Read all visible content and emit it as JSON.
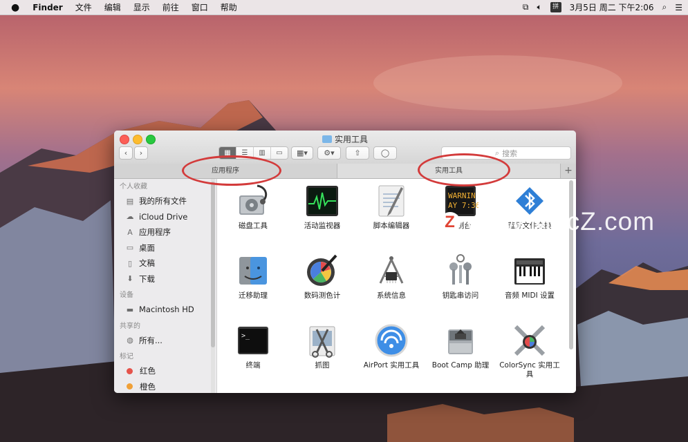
{
  "menubar": {
    "app_name": "Finder",
    "items": [
      "文件",
      "编辑",
      "显示",
      "前往",
      "窗口",
      "帮助"
    ],
    "clock": "3月5日 周二 下午2:06"
  },
  "window": {
    "title": "实用工具",
    "search_placeholder": "搜索",
    "tabs": [
      "应用程序",
      "实用工具"
    ],
    "active_tab": 1
  },
  "sidebar": {
    "favorites_header": "个人收藏",
    "favorites": [
      "我的所有文件",
      "iCloud Drive",
      "应用程序",
      "桌面",
      "文稿",
      "下载"
    ],
    "devices_header": "设备",
    "devices": [
      "Macintosh HD"
    ],
    "shared_header": "共享的",
    "shared": [
      "所有..."
    ],
    "tags_header": "标记",
    "tags": [
      {
        "label": "红色",
        "color": "#e5534b"
      },
      {
        "label": "橙色",
        "color": "#f0a037"
      }
    ]
  },
  "apps": [
    {
      "label": "磁盘工具",
      "icon": "disk-utility-icon"
    },
    {
      "label": "活动监视器",
      "icon": "activity-monitor-icon"
    },
    {
      "label": "脚本编辑器",
      "icon": "script-editor-icon"
    },
    {
      "label": "控制台",
      "icon": "console-icon",
      "screen_text": "WARNIN\nAY 7:36"
    },
    {
      "label": "蓝牙文件交换",
      "icon": "bluetooth-icon"
    },
    {
      "label": "迁移助理",
      "icon": "migration-assistant-icon"
    },
    {
      "label": "数码测色计",
      "icon": "color-meter-icon"
    },
    {
      "label": "系统信息",
      "icon": "system-information-icon"
    },
    {
      "label": "钥匙串访问",
      "icon": "keychain-icon"
    },
    {
      "label": "音频 MIDI 设置",
      "icon": "audio-midi-icon"
    },
    {
      "label": "终端",
      "icon": "terminal-icon",
      "screen_text": ">_"
    },
    {
      "label": "抓图",
      "icon": "grab-icon"
    },
    {
      "label": "AirPort 实用工具",
      "icon": "airport-utility-icon"
    },
    {
      "label": "Boot Camp 助理",
      "icon": "boot-camp-icon"
    },
    {
      "label": "ColorSync 实用工\n具",
      "icon": "colorsync-icon"
    }
  ],
  "watermark": {
    "logo_letter": "Z",
    "text": "www.MacZ.com"
  },
  "colors": {
    "annotation": "#d33b3b",
    "selection": "#6b6b6b"
  }
}
